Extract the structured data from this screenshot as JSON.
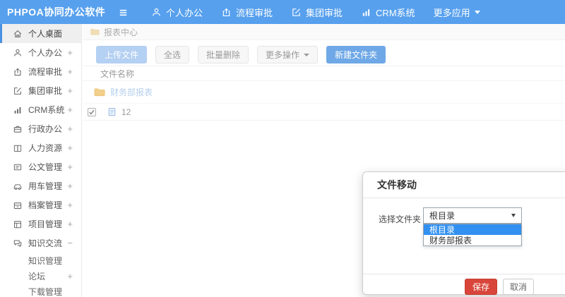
{
  "app": {
    "title": "PHPOA协同办公软件"
  },
  "topbar": {
    "nav": [
      {
        "label": "个人办公"
      },
      {
        "label": "流程审批"
      },
      {
        "label": "集团审批"
      },
      {
        "label": "CRM系统"
      },
      {
        "label": "更多应用"
      }
    ]
  },
  "sidebar": {
    "items": [
      {
        "label": "个人桌面",
        "expand": "",
        "active": true
      },
      {
        "label": "个人办公",
        "expand": "+"
      },
      {
        "label": "流程审批",
        "expand": "+"
      },
      {
        "label": "集团审批",
        "expand": "+"
      },
      {
        "label": "CRM系统",
        "expand": "+"
      },
      {
        "label": "行政办公",
        "expand": "+"
      },
      {
        "label": "人力资源",
        "expand": "+"
      },
      {
        "label": "公文管理",
        "expand": "+"
      },
      {
        "label": "用车管理",
        "expand": "+"
      },
      {
        "label": "档案管理",
        "expand": "+"
      },
      {
        "label": "项目管理",
        "expand": "+"
      },
      {
        "label": "知识交流",
        "expand": "−"
      }
    ],
    "subitems": [
      {
        "label": "知识管理",
        "expand": ""
      },
      {
        "label": "论坛",
        "expand": "+"
      },
      {
        "label": "下载管理",
        "expand": ""
      }
    ]
  },
  "breadcrumb": {
    "current": "报表中心"
  },
  "toolbar": {
    "upload": "上传文件",
    "select_all": "全选",
    "batch_delete": "批量删除",
    "more_ops": "更多操作",
    "new_folder": "新建文件夹"
  },
  "files": {
    "header": "文件名称",
    "rows": [
      {
        "name": "财务部报表",
        "type": "folder"
      },
      {
        "name": "12",
        "type": "file",
        "checked": true
      }
    ]
  },
  "modal": {
    "title": "文件移动",
    "field_label": "选择文件夹",
    "selected": "根目录",
    "options": [
      {
        "label": "根目录",
        "highlighted": true
      },
      {
        "label": "财务部报表",
        "highlighted": false
      }
    ],
    "save": "保存",
    "cancel": "取消"
  },
  "colors": {
    "topbar_blue": "#57a0ee",
    "active_border_blue": "#4a90e2",
    "primary_button": "#6fa8e6",
    "upload_button": "#b4d0f2",
    "danger_red": "#d9453a",
    "option_highlight": "#3190f0",
    "folder_yellow": "#f2cf8a",
    "folder_link": "#b5cfec"
  }
}
